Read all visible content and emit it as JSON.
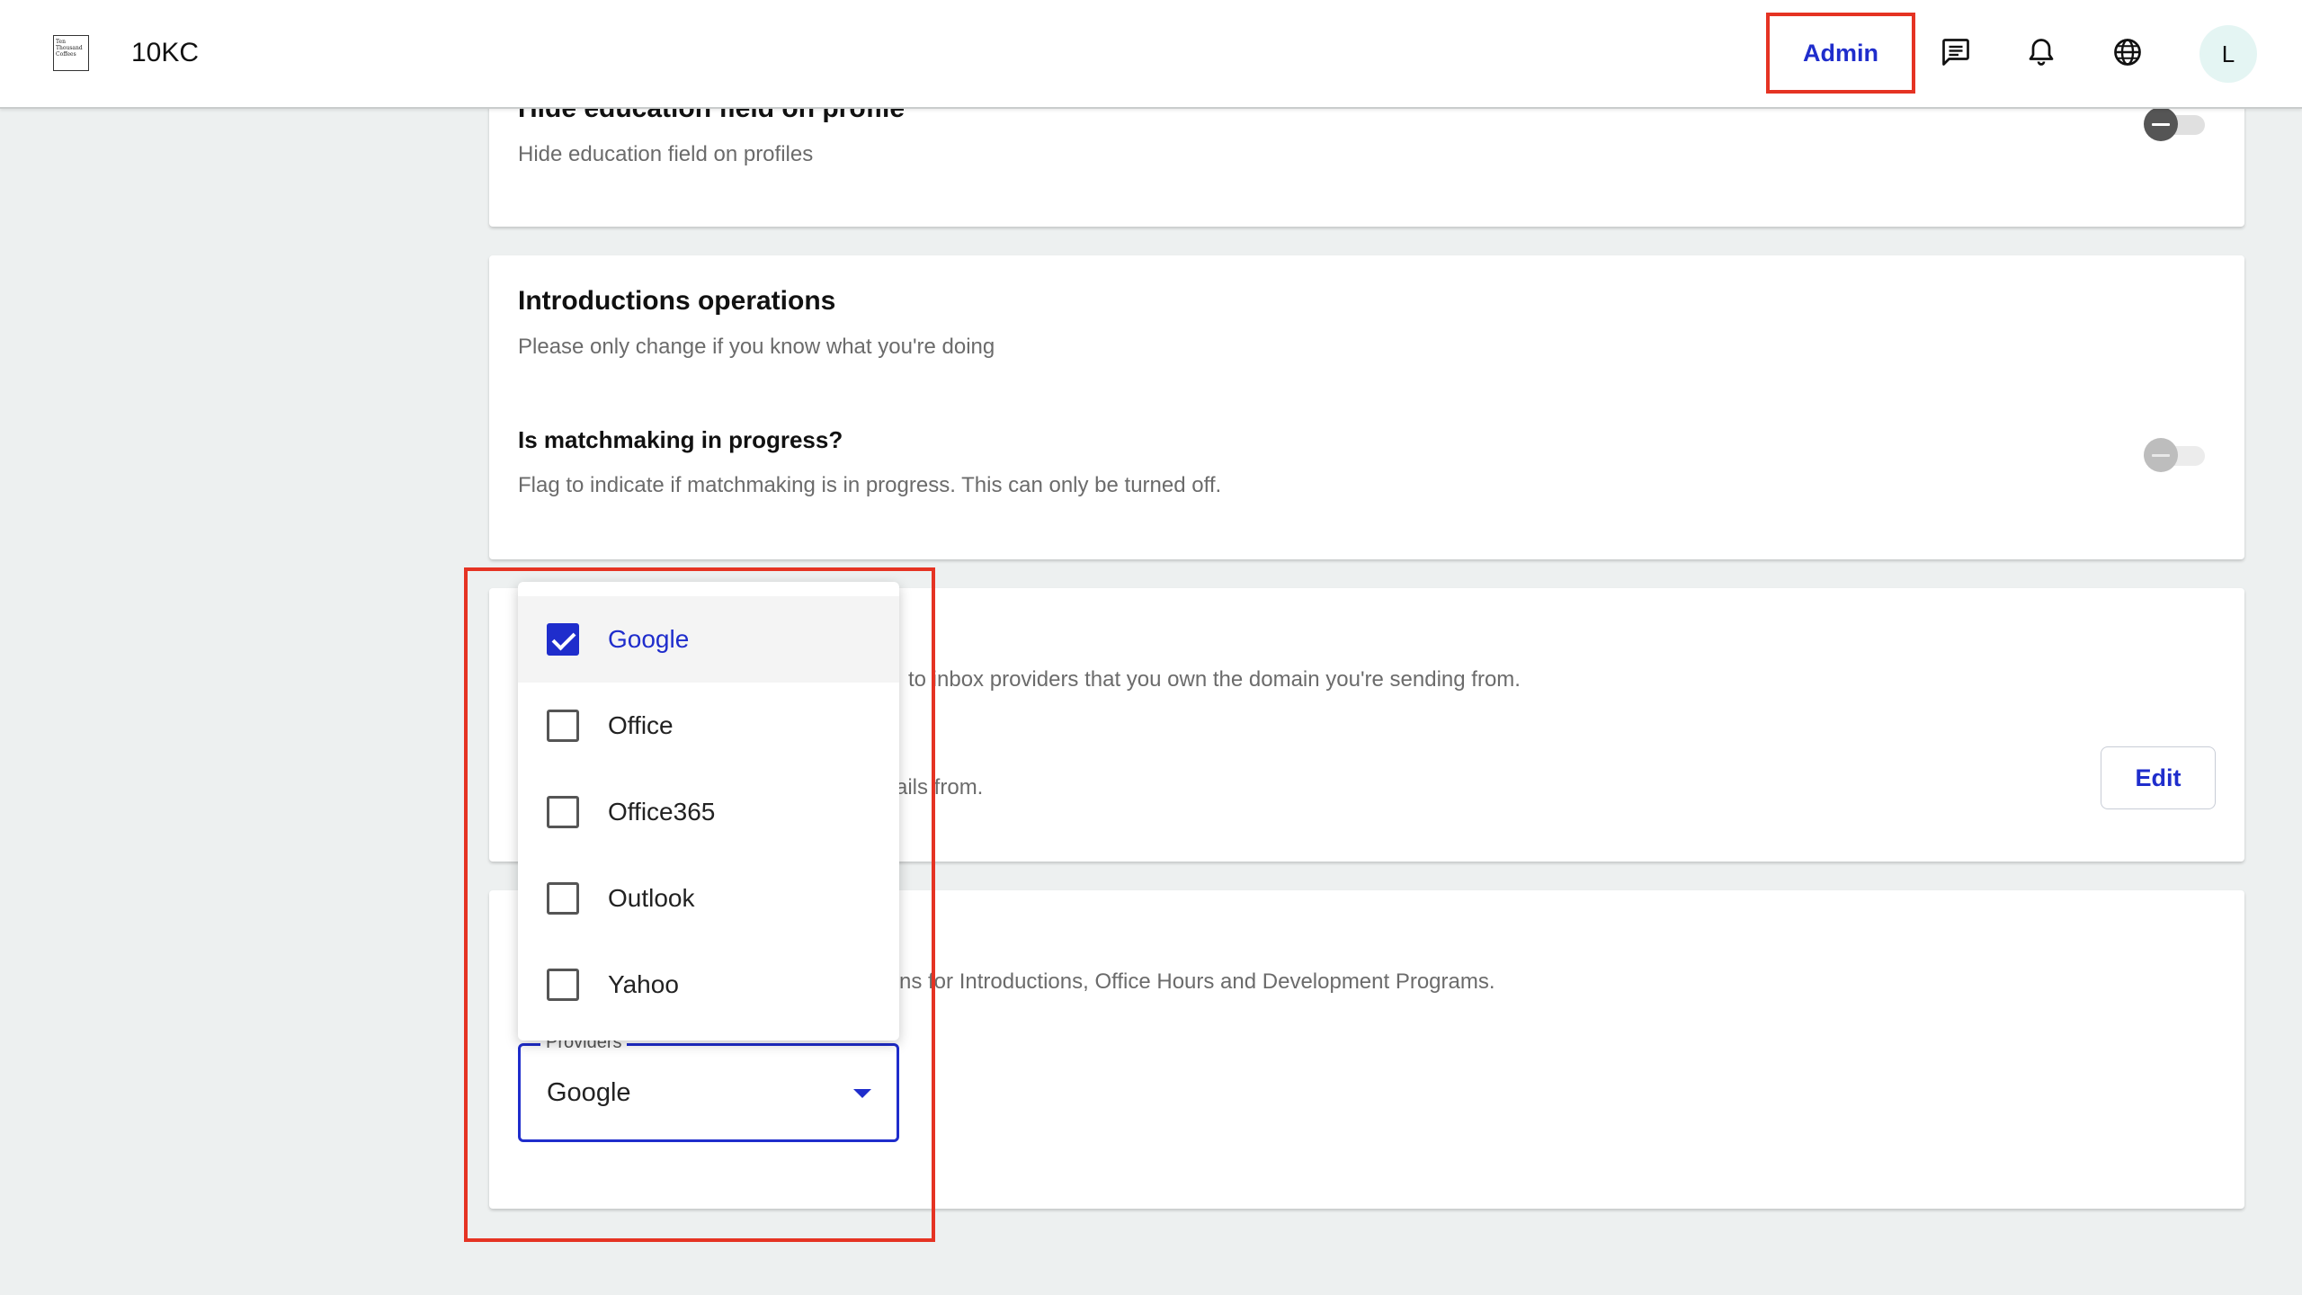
{
  "header": {
    "brand": "10KC",
    "logo_text": "Ten Thousand Coffees",
    "admin_label": "Admin",
    "avatar_initial": "L"
  },
  "cards": {
    "education": {
      "title": "Hide education field on profile",
      "description": "Hide education field on profiles",
      "toggle_on": false
    },
    "introductions": {
      "title": "Introductions operations",
      "description": "Please only change if you know what you're doing",
      "setting_label": "Is matchmaking in progress?",
      "setting_description": "Flag to indicate if matchmaking is in progress. This can only be turned off.",
      "toggle_on": false,
      "toggle_disabled": true
    },
    "email_domain": {
      "description_visible": "to inbox providers that you own the domain you're sending from.",
      "secondary_visible": "ails from.",
      "edit_label": "Edit"
    },
    "calendar": {
      "description_visible": "ns for Introductions, Office Hours and Development Programs."
    }
  },
  "providers": {
    "legend": "Providers",
    "selected_value": "Google",
    "options": [
      {
        "label": "Google",
        "checked": true
      },
      {
        "label": "Office",
        "checked": false
      },
      {
        "label": "Office365",
        "checked": false
      },
      {
        "label": "Outlook",
        "checked": false
      },
      {
        "label": "Yahoo",
        "checked": false
      }
    ]
  },
  "colors": {
    "accent": "#1f2dcc",
    "highlight": "#e53323",
    "background": "#edf0f0"
  },
  "icons": [
    "chat-icon",
    "bell-icon",
    "globe-icon"
  ]
}
